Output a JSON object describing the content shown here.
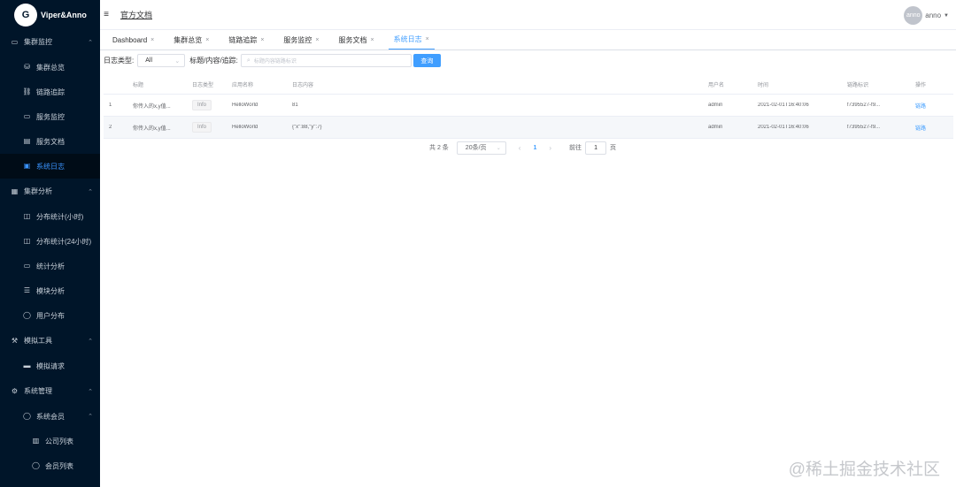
{
  "app": {
    "logo_text": "Viper&Anno",
    "logo_mark": "G"
  },
  "sidebar": {
    "items": [
      {
        "label": "集群监控",
        "type": "group",
        "icon": "monitor-icon",
        "caret": "⌃"
      },
      {
        "label": "集群总览",
        "type": "item",
        "icon": "cluster-icon"
      },
      {
        "label": "链路追踪",
        "type": "item",
        "icon": "link-icon"
      },
      {
        "label": "服务监控",
        "type": "item",
        "icon": "screen-icon"
      },
      {
        "label": "服务文档",
        "type": "item",
        "icon": "doc-icon"
      },
      {
        "label": "系统日志",
        "type": "item",
        "icon": "log-icon",
        "active": true
      },
      {
        "label": "集群分析",
        "type": "group",
        "icon": "briefcase-icon",
        "caret": "⌃"
      },
      {
        "label": "分布统计(小时)",
        "type": "item",
        "icon": "chart-icon"
      },
      {
        "label": "分布统计(24小时)",
        "type": "item",
        "icon": "chart-icon"
      },
      {
        "label": "统计分析",
        "type": "item",
        "icon": "screen-icon"
      },
      {
        "label": "模块分析",
        "type": "item",
        "icon": "sliders-icon"
      },
      {
        "label": "用户分布",
        "type": "item",
        "icon": "user-icon"
      },
      {
        "label": "模拟工具",
        "type": "group",
        "icon": "tool-icon",
        "caret": "⌃"
      },
      {
        "label": "模拟请求",
        "type": "item",
        "icon": "request-icon"
      },
      {
        "label": "系统管理",
        "type": "group",
        "icon": "gear-icon",
        "caret": "⌃"
      },
      {
        "label": "系统会员",
        "type": "item",
        "icon": "user-icon",
        "caret": "⌃"
      },
      {
        "label": "公司列表",
        "type": "sub",
        "icon": "company-icon"
      },
      {
        "label": "会员列表",
        "type": "sub",
        "icon": "user-icon"
      }
    ]
  },
  "header": {
    "menu_icon": "≡",
    "breadcrumb": "官方文档",
    "avatar_text": "anno",
    "user_name": "anno"
  },
  "tabs": [
    {
      "label": "Dashboard",
      "active": false
    },
    {
      "label": "集群总览",
      "active": false
    },
    {
      "label": "链路追踪",
      "active": false
    },
    {
      "label": "服务监控",
      "active": false
    },
    {
      "label": "服务文档",
      "active": false
    },
    {
      "label": "系统日志",
      "active": true
    }
  ],
  "filters": {
    "type_label": "日志类型:",
    "type_value": "All",
    "search_label": "标题/内容/追踪:",
    "search_placeholder": "标题内容链路标识",
    "query_button": "查询"
  },
  "table": {
    "headers": [
      "",
      "标题",
      "日志类型",
      "应用名称",
      "日志内容",
      "用户名",
      "时间",
      "链路标识",
      "操作"
    ],
    "rows": [
      [
        "1",
        "你传入的x,y值...",
        "Info",
        "HelloWorld",
        "81",
        "admin",
        "2021-02-01T16:40:06",
        "f7395527-f9...",
        "链路"
      ],
      [
        "2",
        "你传入的x,y值...",
        "Info",
        "HelloWorld",
        "{\"x\":88,\"y\":7}",
        "admin",
        "2021-02-01T16:40:06",
        "f7395527-f9...",
        "链路"
      ]
    ]
  },
  "pagination": {
    "total": "共 2 条",
    "page_size": "20条/页",
    "prev": "‹",
    "current": "1",
    "next": "›",
    "goto_prefix": "前往",
    "goto_value": "1",
    "goto_suffix": "页"
  },
  "watermark": "@稀土掘金技术社区"
}
